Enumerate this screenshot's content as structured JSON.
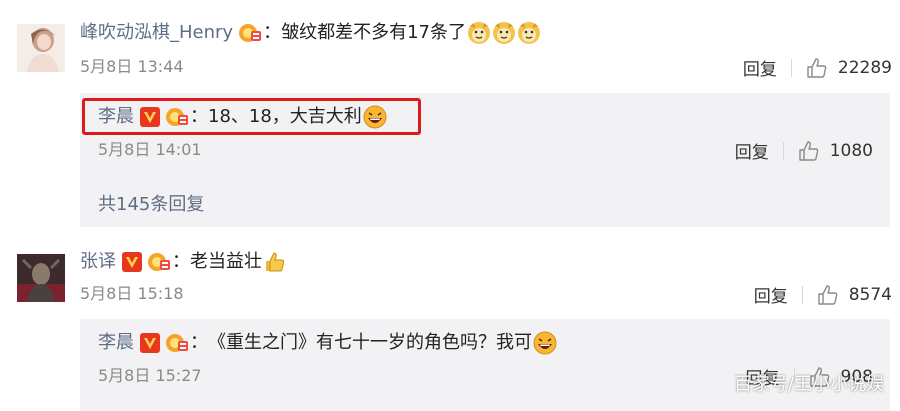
{
  "comments": [
    {
      "username": "峰吹动泓棋_Henry",
      "text": "皱纹都差不多有17条了",
      "time": "5月8日 13:44",
      "reply_label": "回复",
      "likes": "22289",
      "sub_reply": {
        "username": "李晨",
        "text": "18、18，大吉大利",
        "time": "5月8日 14:01",
        "reply_label": "回复",
        "likes": "1080"
      },
      "more_replies": "共145条回复"
    },
    {
      "username": "张译",
      "text": "老当益壮",
      "time": "5月8日 15:18",
      "reply_label": "回复",
      "likes": "8574",
      "sub_reply": {
        "username": "李晨",
        "text": "《重生之门》有七十一岁的角色吗？我可",
        "time": "5月8日 15:27",
        "reply_label": "回复",
        "likes": "908"
      }
    }
  ],
  "colon": "：",
  "watermark": "百家号/王小小说娱",
  "icons": {
    "like": "thumbs-up-outline-icon",
    "verified": "verified-v-badge-icon",
    "member": "vip-crown-badge-icon",
    "doge": "doge-emoji-icon",
    "laugh": "laughing-emoji-icon",
    "thumb": "thumbs-up-emoji-icon"
  },
  "colors": {
    "username": "#5e6f85",
    "highlight": "#e0191e",
    "verified": "#e8371f",
    "subreply_bg": "#f2f2f5"
  }
}
